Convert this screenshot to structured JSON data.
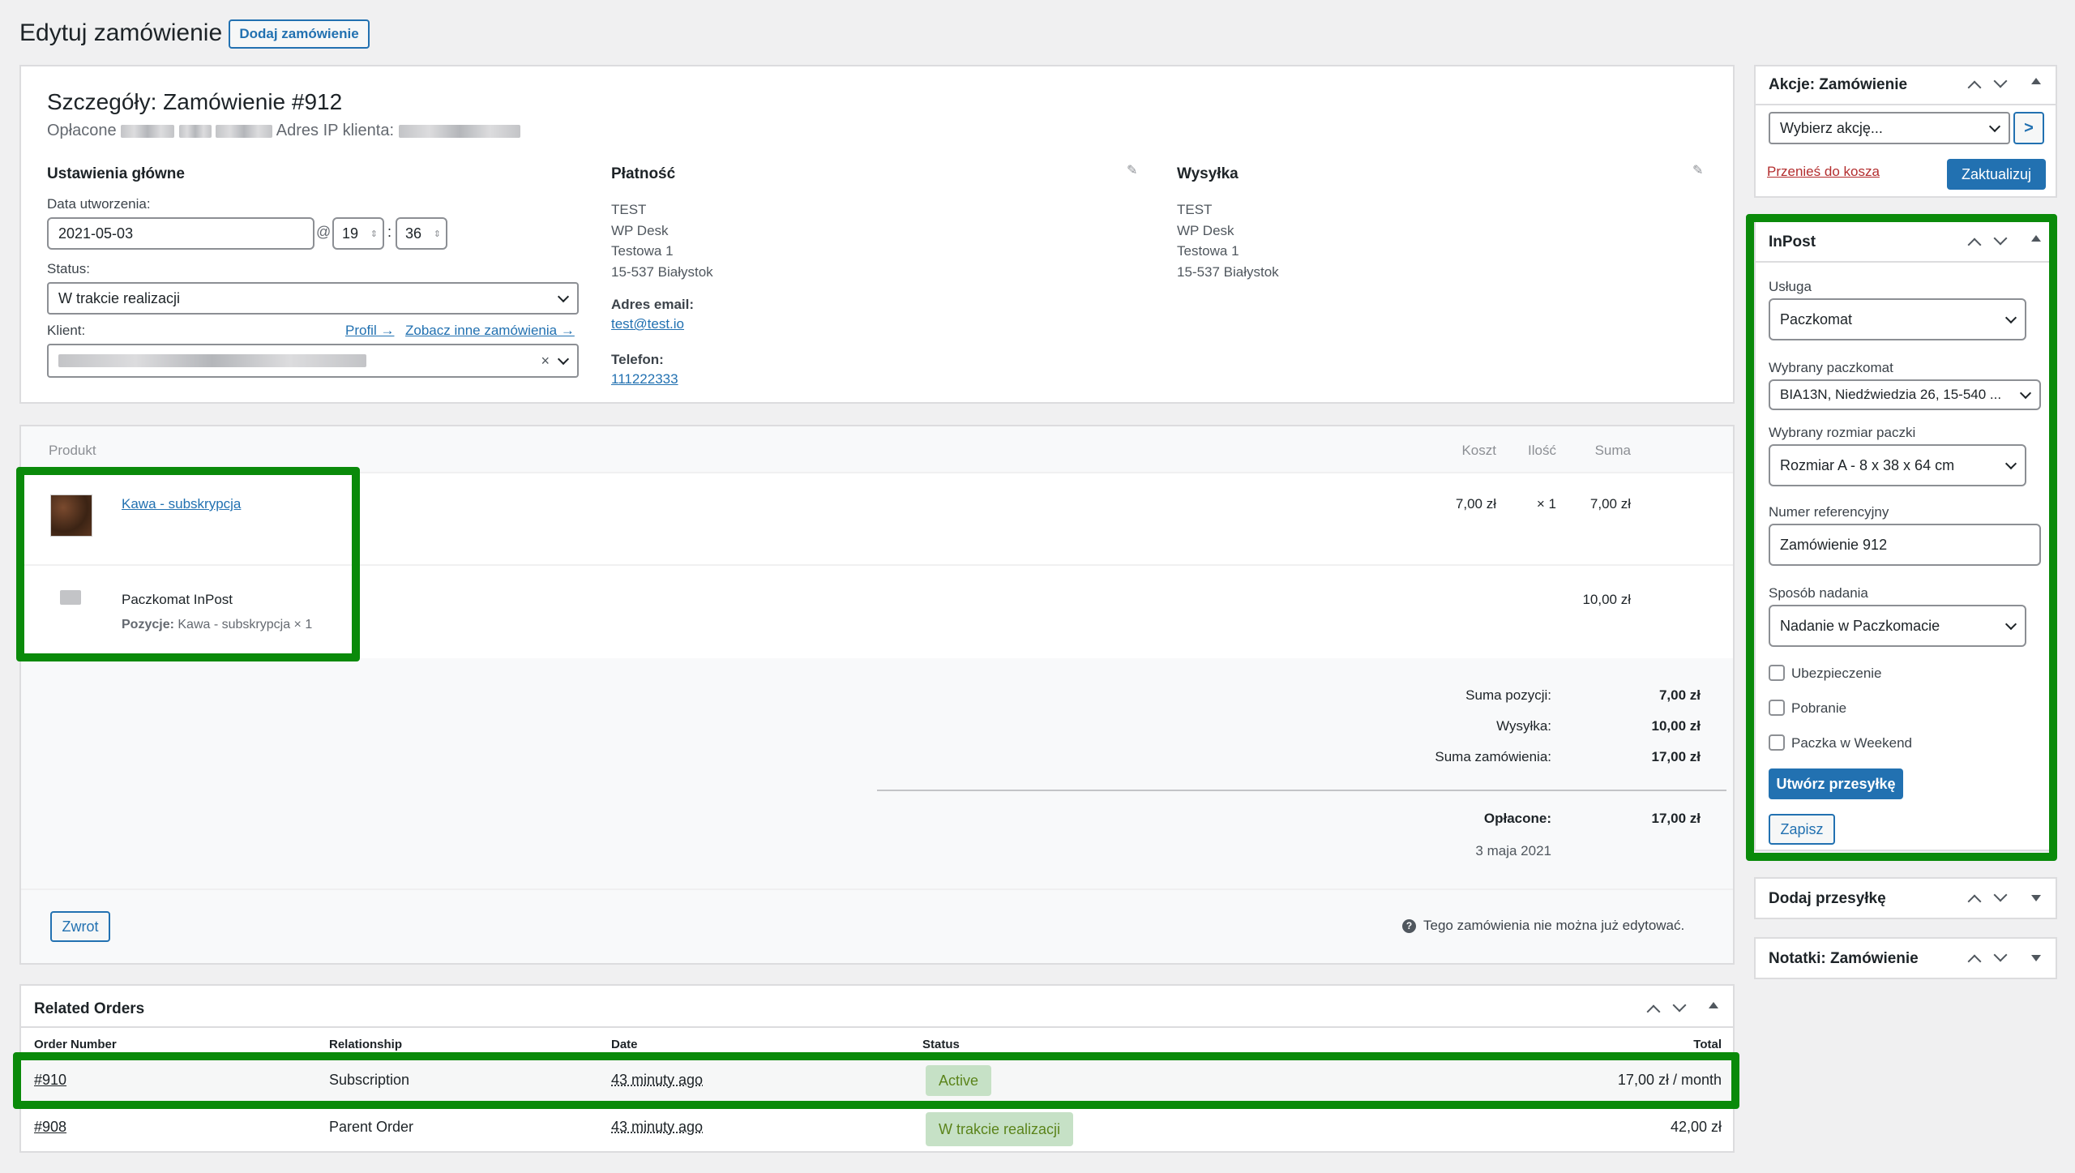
{
  "header": {
    "title": "Edytuj zamówienie",
    "add_button": "Dodaj zamówienie"
  },
  "order": {
    "title": "Szczegóły: Zamówienie #912",
    "paid_prefix": "Opłacone",
    "ip_label": "Adres IP klienta:",
    "general": {
      "heading": "Ustawienia główne",
      "date_label": "Data utworzenia:",
      "date_value": "2021-05-03",
      "at": "@",
      "hour": "19",
      "colon": ":",
      "minute": "36",
      "status_label": "Status:",
      "status_value": "W trakcie realizacji",
      "client_label": "Klient:",
      "profile_link": "Profil →",
      "other_orders_link": "Zobacz inne zamówienia →",
      "clear": "×"
    },
    "payment": {
      "heading": "Płatność",
      "lines": [
        "TEST",
        "WP Desk",
        "Testowa 1",
        "15-537 Białystok"
      ],
      "email_label": "Adres email:",
      "email": "test@test.io",
      "phone_label": "Telefon:",
      "phone": "111222333"
    },
    "shipping": {
      "heading": "Wysyłka",
      "lines": [
        "TEST",
        "WP Desk",
        "Testowa 1",
        "15-537 Białystok"
      ]
    }
  },
  "items": {
    "col_product": "Produkt",
    "col_cost": "Koszt",
    "col_qty": "Ilość",
    "col_total": "Suma",
    "product": {
      "name": "Kawa - subskrypcja",
      "cost": "7,00 zł",
      "qty": "× 1",
      "total": "7,00 zł"
    },
    "shipping_line": {
      "name": "Paczkomat InPost",
      "items_label": "Pozycje:",
      "items_value": "Kawa - subskrypcja × 1",
      "total": "10,00 zł"
    },
    "totals": {
      "items_label": "Suma pozycji:",
      "items_value": "7,00 zł",
      "shipping_label": "Wysyłka:",
      "shipping_value": "10,00 zł",
      "order_label": "Suma zamówienia:",
      "order_value": "17,00 zł",
      "paid_label": "Opłacone:",
      "paid_value": "17,00 zł",
      "paid_date": "3 maja 2021"
    },
    "refund_button": "Zwrot",
    "not_editable": "Tego zamówienia nie można już edytować."
  },
  "related": {
    "title": "Related Orders",
    "headers": [
      "Order Number",
      "Relationship",
      "Date",
      "Status",
      "Total"
    ],
    "rows": [
      {
        "number": "#910",
        "relationship": "Subscription",
        "date": "43 minuty ago",
        "status": "Active",
        "total": "17,00 zł / month"
      },
      {
        "number": "#908",
        "relationship": "Parent Order",
        "date": "43 minuty ago",
        "status": "W trakcie realizacji",
        "total": "42,00 zł"
      }
    ]
  },
  "actions": {
    "title": "Akcje: Zamówienie",
    "select": "Wybierz akcję...",
    "go": ">",
    "trash": "Przenieś do kosza",
    "update": "Zaktualizuj"
  },
  "inpost": {
    "title": "InPost",
    "service_label": "Usługa",
    "service_value": "Paczkomat",
    "locker_label": "Wybrany paczkomat",
    "locker_value": "BIA13N, Niedźwiedzia 26, 15-540 ...",
    "size_label": "Wybrany rozmiar paczki",
    "size_value": "Rozmiar A - 8 x 38 x 64 cm",
    "ref_label": "Numer referencyjny",
    "ref_value": "Zamówienie 912",
    "method_label": "Sposób nadania",
    "method_value": "Nadanie w Paczkomacie",
    "insurance": "Ubezpieczenie",
    "cod": "Pobranie",
    "weekend": "Paczka w Weekend",
    "create_button": "Utwórz przesyłkę",
    "save_button": "Zapisz"
  },
  "add_shipment": {
    "title": "Dodaj przesyłkę"
  },
  "notes": {
    "title": "Notatki: Zamówienie"
  },
  "colors": {
    "accent": "#2271b1",
    "highlight": "#0a8a0a",
    "trash": "#b32d2e"
  }
}
